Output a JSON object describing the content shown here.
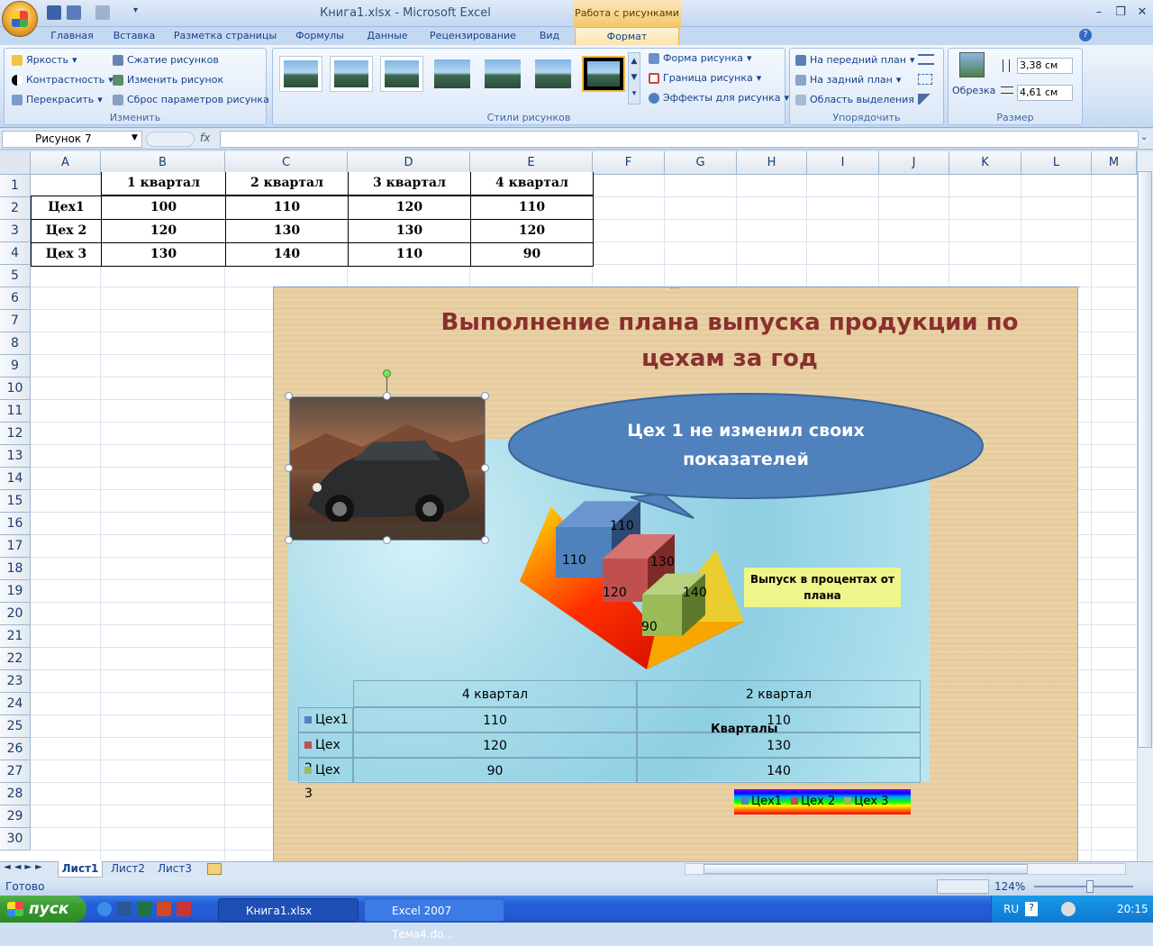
{
  "window": {
    "title": "Книга1.xlsx - Microsoft Excel",
    "context_group": "Работа с рисунками"
  },
  "tabs": [
    "Главная",
    "Вставка",
    "Разметка страницы",
    "Формулы",
    "Данные",
    "Рецензирование",
    "Вид"
  ],
  "active_tab": "Формат",
  "ribbon": {
    "change": {
      "brightness": "Яркость",
      "contrast": "Контрастность",
      "recolor": "Перекрасить",
      "compress": "Сжатие рисунков",
      "change_picture": "Изменить рисунок",
      "reset": "Сброс параметров рисунка",
      "label": "Изменить"
    },
    "styles": {
      "shape": "Форма рисунка",
      "border": "Граница рисунка",
      "effects": "Эффекты для рисунка",
      "label": "Стили рисунков"
    },
    "arrange": {
      "front": "На передний план",
      "back": "На задний план",
      "selection": "Область выделения",
      "label": "Упорядочить"
    },
    "size": {
      "crop": "Обрезка",
      "height": "3,38 см",
      "width": "4,61 см",
      "label": "Размер"
    }
  },
  "formula_bar": {
    "name_box": "Рисунок 7",
    "fx": "fx",
    "content": ""
  },
  "columns": [
    "A",
    "B",
    "C",
    "D",
    "E",
    "F",
    "G",
    "H",
    "I",
    "J",
    "K",
    "L",
    "M"
  ],
  "rows": [
    "1",
    "2",
    "3",
    "4",
    "5",
    "6",
    "7",
    "8",
    "9",
    "10",
    "11",
    "12",
    "13",
    "14",
    "15",
    "16",
    "17",
    "18",
    "19",
    "20",
    "21",
    "22",
    "23",
    "24",
    "25",
    "26",
    "27",
    "28",
    "29",
    "30"
  ],
  "table": {
    "headers": [
      "",
      "1 квартал",
      "2 квартал",
      "3 квартал",
      "4 квартал"
    ],
    "rows": [
      [
        "Цех1",
        "100",
        "110",
        "120",
        "110"
      ],
      [
        "Цех 2",
        "120",
        "130",
        "130",
        "120"
      ],
      [
        "Цех 3",
        "130",
        "140",
        "110",
        "90"
      ]
    ]
  },
  "chart": {
    "title_line1": "Выполнение плана выпуска продукции по",
    "title_line2": "цехам за год",
    "callout_line1": "Цех 1 не изменил своих",
    "callout_line2": "показателей",
    "axis_title_line1": "Выпуск в процентах от",
    "axis_title_line2": "плана",
    "category_axis_title": "Кварталы",
    "bar_labels": [
      "110",
      "110",
      "130",
      "120",
      "140",
      "90"
    ],
    "data_table": {
      "categories": [
        "4 квартал",
        "2 квартал"
      ],
      "series": [
        {
          "name": "Цех1",
          "values": [
            "110",
            "110"
          ]
        },
        {
          "name": "Цех 2",
          "values": [
            "120",
            "130"
          ]
        },
        {
          "name": "Цех 3",
          "values": [
            "90",
            "140"
          ]
        }
      ]
    },
    "legend": [
      "Цех1",
      "Цех 2",
      "Цех 3"
    ],
    "colors": {
      "series1": "#4f81bd",
      "series2": "#c0504d",
      "series3": "#9bbb59",
      "title": "#8b2f2f",
      "callout": "#4f81bd"
    }
  },
  "chart_data": {
    "type": "bar",
    "title": "Выполнение плана выпуска продукции по цехам за год",
    "xlabel": "Кварталы",
    "ylabel": "Выпуск в процентах от плана",
    "categories": [
      "4 квартал",
      "2 квартал"
    ],
    "series": [
      {
        "name": "Цех1",
        "values": [
          110,
          110
        ]
      },
      {
        "name": "Цех 2",
        "values": [
          120,
          130
        ]
      },
      {
        "name": "Цех 3",
        "values": [
          90,
          140
        ]
      }
    ]
  },
  "sheets": [
    "Лист1",
    "Лист2",
    "Лист3"
  ],
  "status": {
    "ready": "Готово",
    "zoom": "124%"
  },
  "taskbar": {
    "start": "пуск",
    "tasks": [
      "Книга1.xlsx",
      "Excel 2007 Тема4.do..."
    ],
    "lang": "RU",
    "time": "20:15"
  }
}
